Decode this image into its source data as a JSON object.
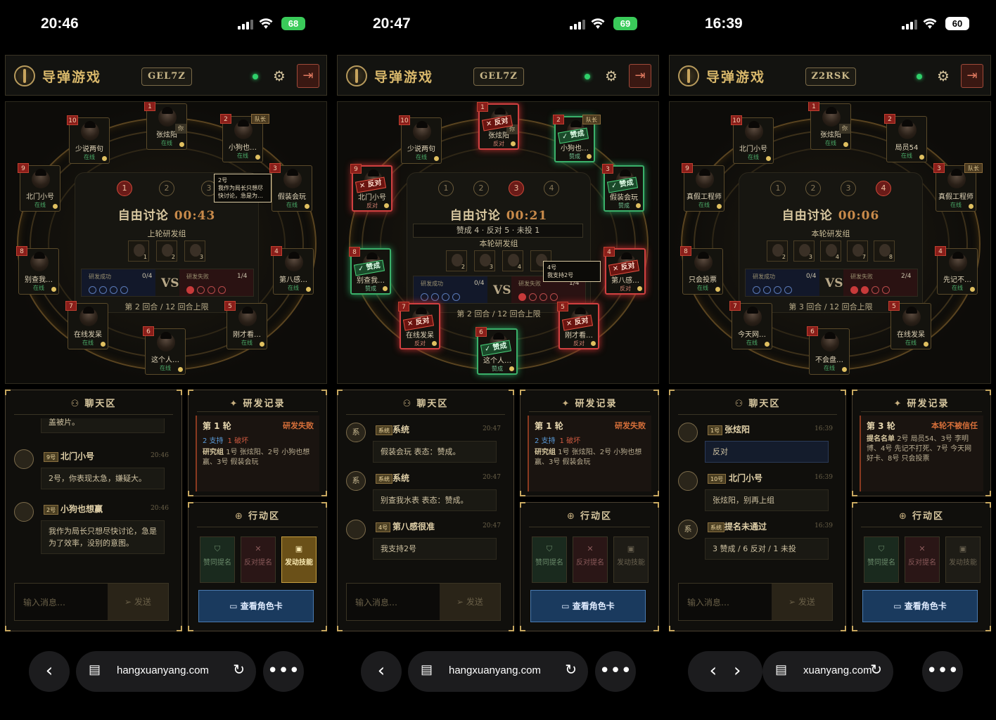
{
  "screens": [
    {
      "status": {
        "time": "20:46",
        "battery": "68"
      },
      "header": {
        "title": "导弹游戏",
        "room": "GEL7Z"
      },
      "round_nums": [
        "1",
        "2",
        "3"
      ],
      "phase": "自由讨论",
      "timer": "00:43",
      "group_label": "上轮研发组",
      "chips": [
        "1",
        "2",
        "3"
      ],
      "score": {
        "left_label": "研发成功",
        "left_count": "0/4",
        "right_label": "研发失败",
        "right_count": "1/4",
        "vs": "VS"
      },
      "round_info": "第 2 回合  /  12 回合上限",
      "seats": [
        {
          "n": "1",
          "name": "张炫阳",
          "st": "在线",
          "you": "你"
        },
        {
          "n": "2",
          "name": "小狗也…",
          "st": "在线",
          "tag": "队长"
        },
        {
          "n": "3",
          "name": "假装会玩",
          "st": "在线"
        },
        {
          "n": "4",
          "name": "第八感…",
          "st": "在线"
        },
        {
          "n": "5",
          "name": "刚才看…",
          "st": "在线"
        },
        {
          "n": "6",
          "name": "这个人…",
          "st": "在线"
        },
        {
          "n": "7",
          "name": "在线发呆",
          "st": "在线"
        },
        {
          "n": "8",
          "name": "别查我…",
          "st": "在线"
        },
        {
          "n": "9",
          "name": "北门小号",
          "st": "在线"
        },
        {
          "n": "10",
          "name": "少说两句",
          "st": "在线"
        }
      ],
      "tooltip": {
        "line1": "2号",
        "line2": "我作为局长只想尽",
        "line3": "快讨论，急是为…"
      },
      "chat": {
        "title": "聊天区",
        "partial": "盖被片。",
        "messages": [
          {
            "badge": "9号",
            "who": "北门小号",
            "time": "20:46",
            "text": "2号，你表现太急，嫌疑大。"
          },
          {
            "badge": "2号",
            "who": "小狗也想赢",
            "time": "20:46",
            "text": "我作为局长只想尽快讨论，急是为了效率，没别的意图。"
          }
        ],
        "placeholder": "输入消息…",
        "send": "发送"
      },
      "record": {
        "title": "研发记录",
        "round": "第 1 轮",
        "result": "研发失败",
        "support": "2 支持",
        "bad": "1 破坏",
        "group_key": "研究组",
        "group_text": "1号 张炫阳、2号 小狗也想赢、3号 假装会玩"
      },
      "actions": {
        "title": "行动区",
        "b1": "赞同提名",
        "b2": "反对提名",
        "b3": "发动技能",
        "card": "查看角色卡"
      },
      "browser": {
        "url": "hangxuanyang.com"
      }
    },
    {
      "status": {
        "time": "20:47",
        "battery": "69"
      },
      "header": {
        "title": "导弹游戏",
        "room": "GEL7Z"
      },
      "round_nums": [
        "1",
        "2",
        "3",
        "4"
      ],
      "phase": "自由讨论",
      "timer": "00:21",
      "vote_bar": "赞成 4 · 反对 5 · 未投 1",
      "group_label": "本轮研发组",
      "chips": [
        "2",
        "3",
        "4",
        "8"
      ],
      "score": {
        "left_label": "研发成功",
        "left_count": "0/4",
        "right_label": "研发失败",
        "right_count": "1/4",
        "vs": "VS"
      },
      "round_info": "第 2 回合  /  12 回合上限",
      "seats": [
        {
          "n": "1",
          "name": "张炫阳",
          "st": "反对",
          "you": "你",
          "stamp": "✕ 反对"
        },
        {
          "n": "2",
          "name": "小狗也…",
          "st": "赞成",
          "tag": "队长",
          "stamp": "✓ 赞成"
        },
        {
          "n": "3",
          "name": "假装会玩",
          "st": "赞成",
          "stamp": "✓ 赞成"
        },
        {
          "n": "4",
          "name": "第八感…",
          "st": "反对",
          "stamp": "✕ 反对"
        },
        {
          "n": "5",
          "name": "刚才看…",
          "st": "反对",
          "stamp": "✕ 反对"
        },
        {
          "n": "6",
          "name": "这个人…",
          "st": "赞成",
          "stamp": "✓ 赞成"
        },
        {
          "n": "7",
          "name": "在线发呆",
          "st": "反对",
          "stamp": "✕ 反对"
        },
        {
          "n": "8",
          "name": "别查我…",
          "st": "赞成",
          "stamp": "✓ 赞成"
        },
        {
          "n": "9",
          "name": "北门小号",
          "st": "反对",
          "stamp": "✕ 反对"
        },
        {
          "n": "10",
          "name": "少说两句",
          "st": "在线"
        }
      ],
      "tooltip": {
        "line1": "4号",
        "line2": "我支持2号",
        "line3": ""
      },
      "chat": {
        "title": "聊天区",
        "messages": [
          {
            "avatar": "系",
            "badge": "系统",
            "who": "系统",
            "time": "20:47",
            "text": "假装会玩 表态：赞成。"
          },
          {
            "avatar": "系",
            "badge": "系统",
            "who": "系统",
            "time": "20:47",
            "text": "别查我水表 表态：赞成。"
          },
          {
            "badge": "4号",
            "who": "第八感很准",
            "time": "20:47",
            "text": "我支持2号"
          }
        ],
        "placeholder": "输入消息…",
        "send": "发送"
      },
      "record": {
        "title": "研发记录",
        "round": "第 1 轮",
        "result": "研发失败",
        "support": "2 支持",
        "bad": "1 破坏",
        "group_key": "研究组",
        "group_text": "1号 张炫阳、2号 小狗也想赢、3号 假装会玩"
      },
      "actions": {
        "title": "行动区",
        "b1": "赞同提名",
        "b2": "反对提名",
        "b3": "发动技能",
        "card": "查看角色卡"
      },
      "browser": {
        "url": "hangxuanyang.com"
      }
    },
    {
      "status": {
        "time": "16:39",
        "battery": "60"
      },
      "header": {
        "title": "导弹游戏",
        "room": "Z2RSK"
      },
      "round_nums": [
        "1",
        "2",
        "3",
        "4"
      ],
      "phase": "自由讨论",
      "timer": "00:06",
      "group_label": "本轮研发组",
      "chips": [
        "2",
        "3",
        "4",
        "7",
        "8"
      ],
      "score": {
        "left_label": "研发成功",
        "left_count": "0/4",
        "right_label": "研发失败",
        "right_count": "2/4",
        "vs": "VS"
      },
      "round_info": "第 3 回合  /  12 回合上限",
      "seats": [
        {
          "n": "1",
          "name": "张炫阳",
          "st": "在线",
          "you": "你"
        },
        {
          "n": "2",
          "name": "局员54",
          "st": "在线"
        },
        {
          "n": "3",
          "name": "真假工程师",
          "st": "在线",
          "tag": "队长"
        },
        {
          "n": "4",
          "name": "先记不…",
          "st": "在线"
        },
        {
          "n": "5",
          "name": "在线发呆",
          "st": "在线"
        },
        {
          "n": "6",
          "name": "不会盘…",
          "st": "在线"
        },
        {
          "n": "7",
          "name": "今天网…",
          "st": "在线"
        },
        {
          "n": "8",
          "name": "只会投票",
          "st": "在线"
        },
        {
          "n": "9",
          "name": "真假工程师",
          "st": "在线"
        },
        {
          "n": "10",
          "name": "北门小号",
          "st": "在线"
        }
      ],
      "chat": {
        "title": "聊天区",
        "messages": [
          {
            "badge": "1号",
            "who": "张炫阳",
            "time": "16:39",
            "text": "反对",
            "blue": true
          },
          {
            "badge": "10号",
            "who": "北门小号",
            "time": "16:39",
            "text": "张炫阳，别再上组"
          },
          {
            "avatar": "系",
            "badge": "系统",
            "who": "提名未通过",
            "time": "16:39",
            "text": "3 赞成 / 6 反对 / 1 未投"
          }
        ],
        "placeholder": "输入消息…",
        "send": "发送"
      },
      "record": {
        "title": "研发记录",
        "round": "第 3 轮",
        "result": "本轮不被信任",
        "group_key": "提名名单",
        "group_text": "2号 局员54、3号 李明博、4号 先记不打死、7号 今天网好卡、8号 只会投票"
      },
      "actions": {
        "title": "行动区",
        "b1": "赞同提名",
        "b2": "反对提名",
        "b3": "发动技能",
        "card": "查看角色卡"
      },
      "browser": {
        "url": "xuanyang.com"
      }
    }
  ]
}
